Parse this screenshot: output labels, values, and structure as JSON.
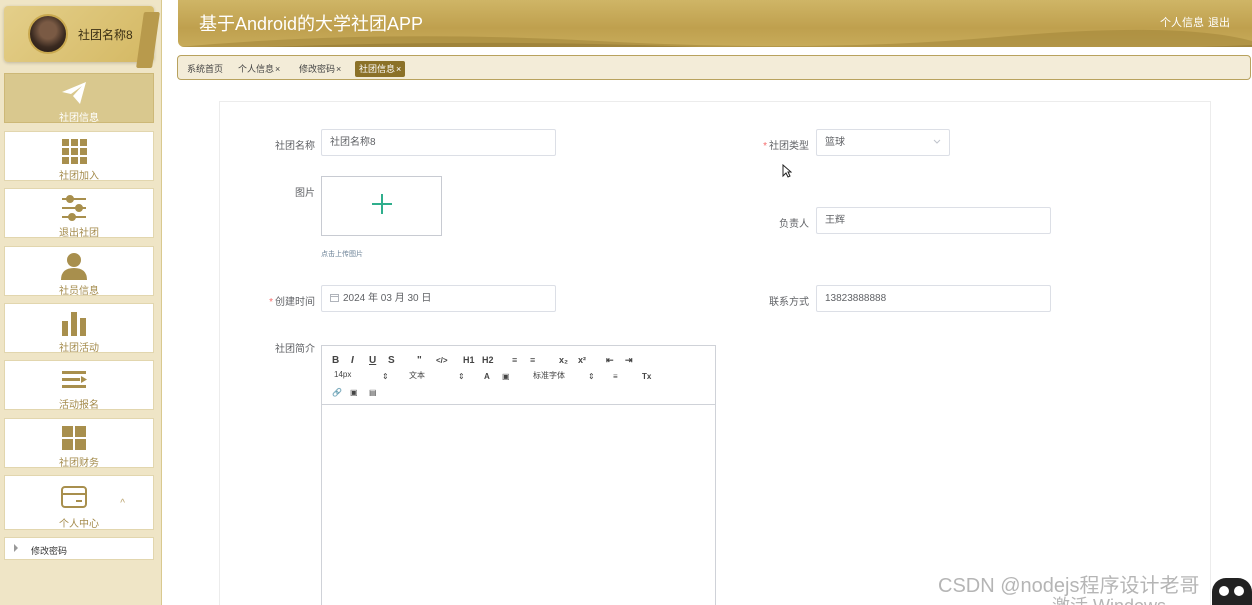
{
  "app": {
    "title": "基于Android的大学社团APP",
    "header_links": [
      "个人信息",
      "退出"
    ]
  },
  "user": {
    "name": "社团名称8"
  },
  "sidebar": {
    "items": [
      {
        "label": "社团信息",
        "icon": "paper-plane-icon",
        "active": true
      },
      {
        "label": "社团加入",
        "icon": "grid-icon"
      },
      {
        "label": "退出社团",
        "icon": "sliders-icon"
      },
      {
        "label": "社员信息",
        "icon": "user-icon"
      },
      {
        "label": "社团活动",
        "icon": "bar-chart-icon"
      },
      {
        "label": "活动报名",
        "icon": "list-icon"
      },
      {
        "label": "社团财务",
        "icon": "tiles-icon"
      },
      {
        "label": "个人中心",
        "icon": "card-icon",
        "expand": "^"
      }
    ],
    "sub_item": "修改密码"
  },
  "tabs": [
    {
      "label": "系统首页",
      "closable": false
    },
    {
      "label": "个人信息",
      "closable": true
    },
    {
      "label": "修改密码",
      "closable": true
    },
    {
      "label": "社团信息",
      "closable": true,
      "active": true
    }
  ],
  "tab_close": "×",
  "required_mark": "*",
  "form": {
    "name": {
      "label": "社团名称",
      "value": "社团名称8"
    },
    "type": {
      "label": "社团类型",
      "value": "篮球",
      "required": true
    },
    "image": {
      "label": "图片",
      "hint": "点击上传图片"
    },
    "leader": {
      "label": "负责人",
      "value": "王辉"
    },
    "created": {
      "label": "创建时间",
      "value": "2024 年 03 月 30 日",
      "required": true
    },
    "contact": {
      "label": "联系方式",
      "value": "13823888888"
    },
    "intro": {
      "label": "社团简介"
    }
  },
  "editor": {
    "font_size": "14px",
    "block_type": "文本",
    "font_family": "标准字体"
  },
  "overlay": {
    "watermark": "CSDN @nodejs程序设计老哥",
    "activate": "激活 Windows"
  },
  "colors": {
    "gold": "#bfa04e",
    "active_tab": "#8b7128",
    "required": "#f56c6c",
    "upload_plus": "#2fae8c"
  }
}
